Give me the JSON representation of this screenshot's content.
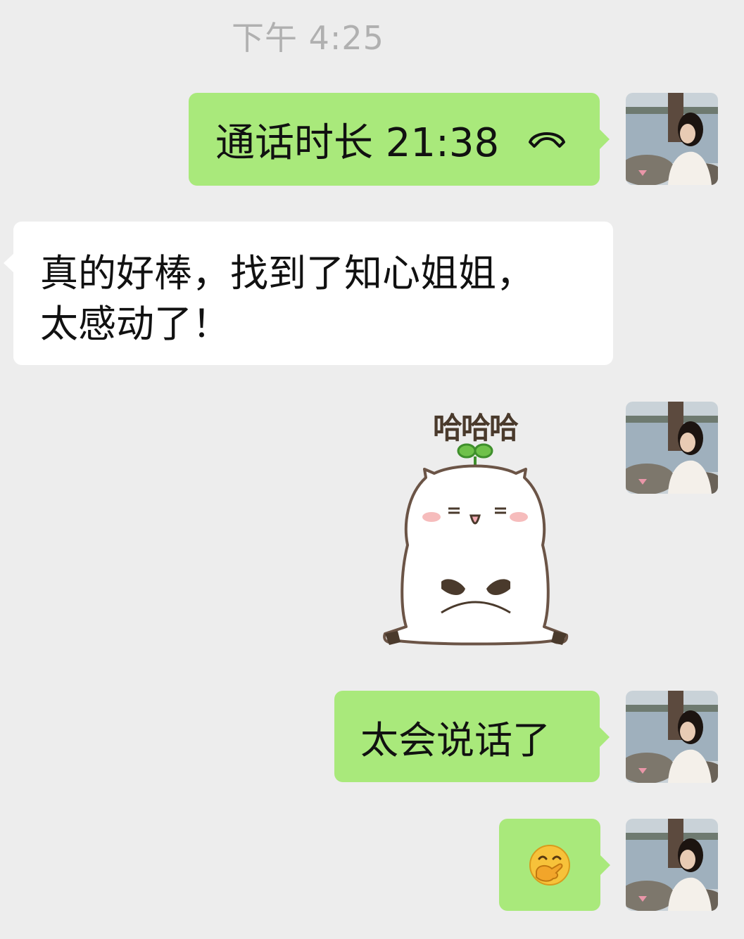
{
  "chat": {
    "timestamp": "下午 4:25",
    "messages": [
      {
        "side": "me",
        "type": "call",
        "text": "通话时长 21:38",
        "icon": "phone-hangup-icon"
      },
      {
        "side": "them",
        "type": "text",
        "line1": "真的好棒，找到了知心姐姐，",
        "line2": "太感动了！"
      },
      {
        "side": "me",
        "type": "sticker",
        "label": "哈哈哈"
      },
      {
        "side": "me",
        "type": "text",
        "text": "太会说话了"
      },
      {
        "side": "me",
        "type": "emoji",
        "icon": "face-with-hand-over-mouth-icon"
      }
    ]
  },
  "colors": {
    "background": "#ededed",
    "my_bubble": "#a9e97b",
    "their_bubble": "#ffffff"
  }
}
